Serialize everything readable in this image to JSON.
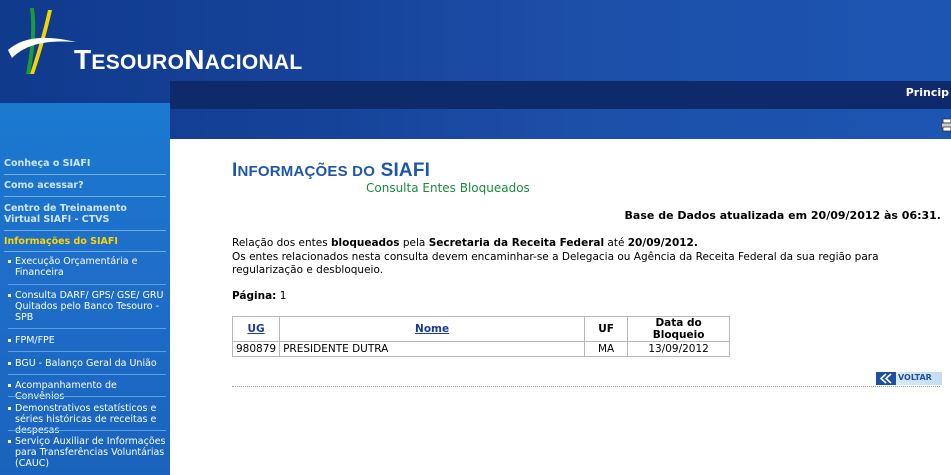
{
  "header": {
    "brand_prefix": "T",
    "brand_mid": "ESOURO",
    "brand_mid2": "N",
    "brand_end": "ACIONAL",
    "nav_link": "Princip",
    "colors": {
      "header_bg": "#16439a",
      "navbar_bg": "#0f2a6b",
      "logo_green": "#1a9a3a",
      "logo_yellow": "#f2d400"
    }
  },
  "sidebar": {
    "top_items": [
      {
        "label": "Conheça o SIAFI"
      },
      {
        "label": "Como acessar?"
      },
      {
        "label": "Centro de Treinamento Virtual SIAFI - CTVS"
      },
      {
        "label": "Informações do SIAFI"
      }
    ],
    "sub_items": [
      {
        "label": "Execução Orçamentária e Financeira"
      },
      {
        "label": "Consulta DARF/ GPS/ GSE/ GRU Quitados pelo Banco Tesouro - SPB"
      },
      {
        "label": "FPM/FPE"
      },
      {
        "label": "BGU - Balanço Geral da União"
      },
      {
        "label": "Acompanhamento de Convênios"
      },
      {
        "label": "Demonstrativos estatísticos e séries históricas de receitas e despesas"
      },
      {
        "label": "Serviço Auxiliar de Informações para Transferências Voluntárias (CAUC)"
      }
    ]
  },
  "main": {
    "title_word1_big": "I",
    "title_word1_rest": "NFORMAÇÕES DO",
    "title_word2": " SIAFI",
    "subtitle": "Consulta Entes Bloqueados",
    "db_date": "Base de Dados atualizada em 20/09/2012 às 06:31.",
    "rel_prefix": "Relação dos entes ",
    "rel_bold1": "bloqueados",
    "rel_mid": " pela ",
    "rel_bold2": "Secretaria da Receita Federal",
    "rel_mid2": " até ",
    "rel_bold3": "20/09/2012.",
    "info": "Os entes relacionados nesta consulta devem encaminhar-se a Delegacia ou Agência da Receita Federal da sua região para regularização e desbloqueio.",
    "pagina_label": "Página:",
    "pagina_value": "1",
    "table": {
      "headers": {
        "ug": "UG",
        "nome": "Nome",
        "uf": "UF",
        "data": "Data do Bloqueio"
      },
      "rows": [
        {
          "ug": "980879",
          "nome": "PRESIDENTE DUTRA",
          "uf": "MA",
          "data": "13/09/2012"
        }
      ]
    },
    "voltar_label": "VOLTAR"
  }
}
